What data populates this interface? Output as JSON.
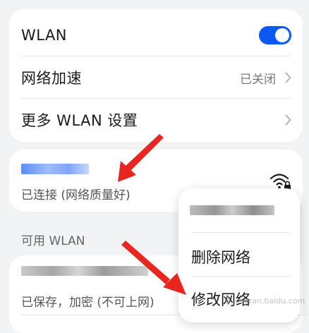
{
  "settings": {
    "wlan_label": "WLAN",
    "wlan_toggle_on": true,
    "network_accel_label": "网络加速",
    "network_accel_value": "已关闭",
    "more_settings_label": "更多 WLAN 设置"
  },
  "connected": {
    "status": "已连接 (网络质量好)",
    "icon": "wifi-lock-icon"
  },
  "available": {
    "section_title": "可用 WLAN",
    "first_status": "已保存，加密 (不可上网)"
  },
  "context_menu": {
    "delete_label": "删除网络",
    "modify_label": "修改网络"
  },
  "colors": {
    "accent": "#0a59f7",
    "arrow": "#e8261f"
  }
}
